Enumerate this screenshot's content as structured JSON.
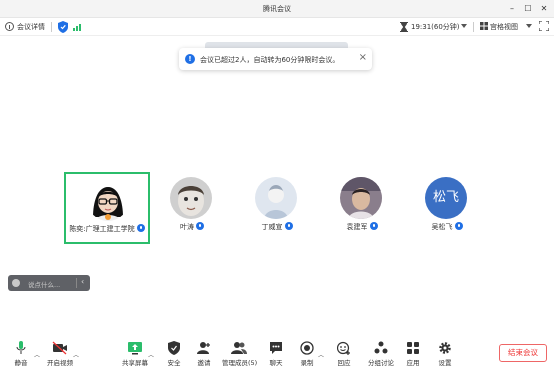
{
  "window": {
    "title": "腾讯会议"
  },
  "infobar": {
    "meeting_details": "会议详情",
    "timer": "19:31(60分钟)",
    "view_mode": "宫格视图"
  },
  "notice": {
    "text": "会议已超过2人，自动转为60分钟限时会议。"
  },
  "participants": [
    {
      "name": "陈奕:广理工建工学院",
      "active": true
    },
    {
      "name": "叶涛",
      "active": false
    },
    {
      "name": "丁威宣",
      "active": false
    },
    {
      "name": "袁建军",
      "active": false
    },
    {
      "name": "吴松飞",
      "active": false,
      "avatar_text": "松飞"
    }
  ],
  "chat": {
    "placeholder": "说点什么..."
  },
  "toolbar": {
    "mute": "静音",
    "video": "开启视频",
    "share": "共享屏幕",
    "security": "安全",
    "invite": "邀请",
    "members": "管理成员(5)",
    "chat": "聊天",
    "record": "录制",
    "reactions": "回应",
    "breakout": "分组讨论",
    "apps": "应用",
    "settings": "设置",
    "end": "结束会议"
  },
  "colors": {
    "accent": "#1f6fe5",
    "active_border": "#2bbd6b",
    "end": "#e33333"
  }
}
